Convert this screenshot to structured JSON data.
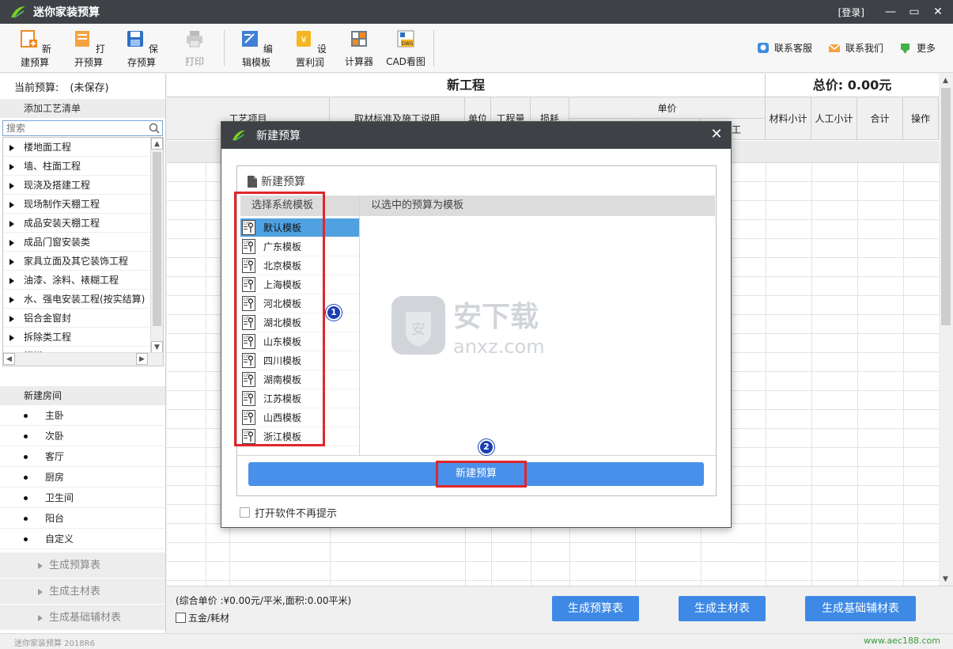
{
  "app": {
    "title": "迷你家装预算",
    "login": "[登录]"
  },
  "toolbar": {
    "items": [
      {
        "label": "新建预算",
        "icon": "new-file-icon"
      },
      {
        "label": "打开预算",
        "icon": "open-file-icon"
      },
      {
        "label": "保存预算",
        "icon": "save-icon"
      },
      {
        "label": "打印",
        "icon": "print-icon",
        "disabled": true
      },
      {
        "label": "编辑模板",
        "icon": "edit-template-icon"
      },
      {
        "label": "设置利润",
        "icon": "profit-icon"
      },
      {
        "label": "计算器",
        "icon": "calculator-icon"
      },
      {
        "label": "CAD看图",
        "icon": "cad-icon"
      }
    ],
    "right": [
      {
        "label": "联系客服",
        "icon": "chat-icon"
      },
      {
        "label": "联系我们",
        "icon": "mail-icon"
      },
      {
        "label": "更多",
        "icon": "more-icon"
      }
    ]
  },
  "left": {
    "current_label": "当前预算:",
    "current_value": "(未保存)",
    "craft_header": "添加工艺清单",
    "search_placeholder": "搜索",
    "categories": [
      "楼地面工程",
      "墙、柱面工程",
      "现浇及搭建工程",
      "现场制作天棚工程",
      "成品安装天棚工程",
      "成品门窗安装类",
      "家具立面及其它装饰工程",
      "油漆、涂料、裱糊工程",
      "水、强电安装工程(按实结算)",
      "铝合金窗封",
      "拆除类工程",
      "楼梯"
    ],
    "room_header": "新建房间",
    "rooms": [
      "主卧",
      "次卧",
      "客厅",
      "厨房",
      "卫生间",
      "阳台",
      "自定义"
    ],
    "generate": [
      "生成预算表",
      "生成主材表",
      "生成基础辅材表"
    ]
  },
  "main": {
    "project_title": "新工程",
    "total": "总价:  0.00元",
    "headers": {
      "item": "工艺项目",
      "standard": "取材标准及施工说明",
      "unit": "单位",
      "qty": "工程量",
      "loss": "损耗",
      "unit_price": "单价",
      "labor_partial": "工",
      "material_subtotal": "材料小计",
      "labor_subtotal": "人工小计",
      "total": "合计",
      "action": "操作"
    }
  },
  "bottom": {
    "summary": "(综合单价 :¥0.00元/平米,面积:0.00平米)",
    "hardware": "五金/耗材",
    "buttons": [
      "生成预算表",
      "生成主材表",
      "生成基础辅材表"
    ]
  },
  "status": {
    "version": "迷你家装预算 2018R6",
    "site": "www.aec188.com"
  },
  "dialog": {
    "title": "新建预算",
    "box_title": "新建预算",
    "col_system": "选择系统模板",
    "col_selected": "以选中的预算为模板",
    "templates": [
      "默认模板",
      "广东模板",
      "北京模板",
      "上海模板",
      "河北模板",
      "湖北模板",
      "山东模板",
      "四川模板",
      "湖南模板",
      "江苏模板",
      "山西模板",
      "浙江模板"
    ],
    "selected_index": 0,
    "create_button": "新建预算",
    "no_prompt": "打开软件不再提示",
    "badges": [
      "1",
      "2"
    ]
  },
  "watermark": {
    "text": "安下载",
    "sub": "anxz.com"
  },
  "colors": {
    "titlebar": "#3e4247",
    "accent": "#3d89e5",
    "highlight": "#e0262a",
    "selected": "#4fa1e0"
  }
}
